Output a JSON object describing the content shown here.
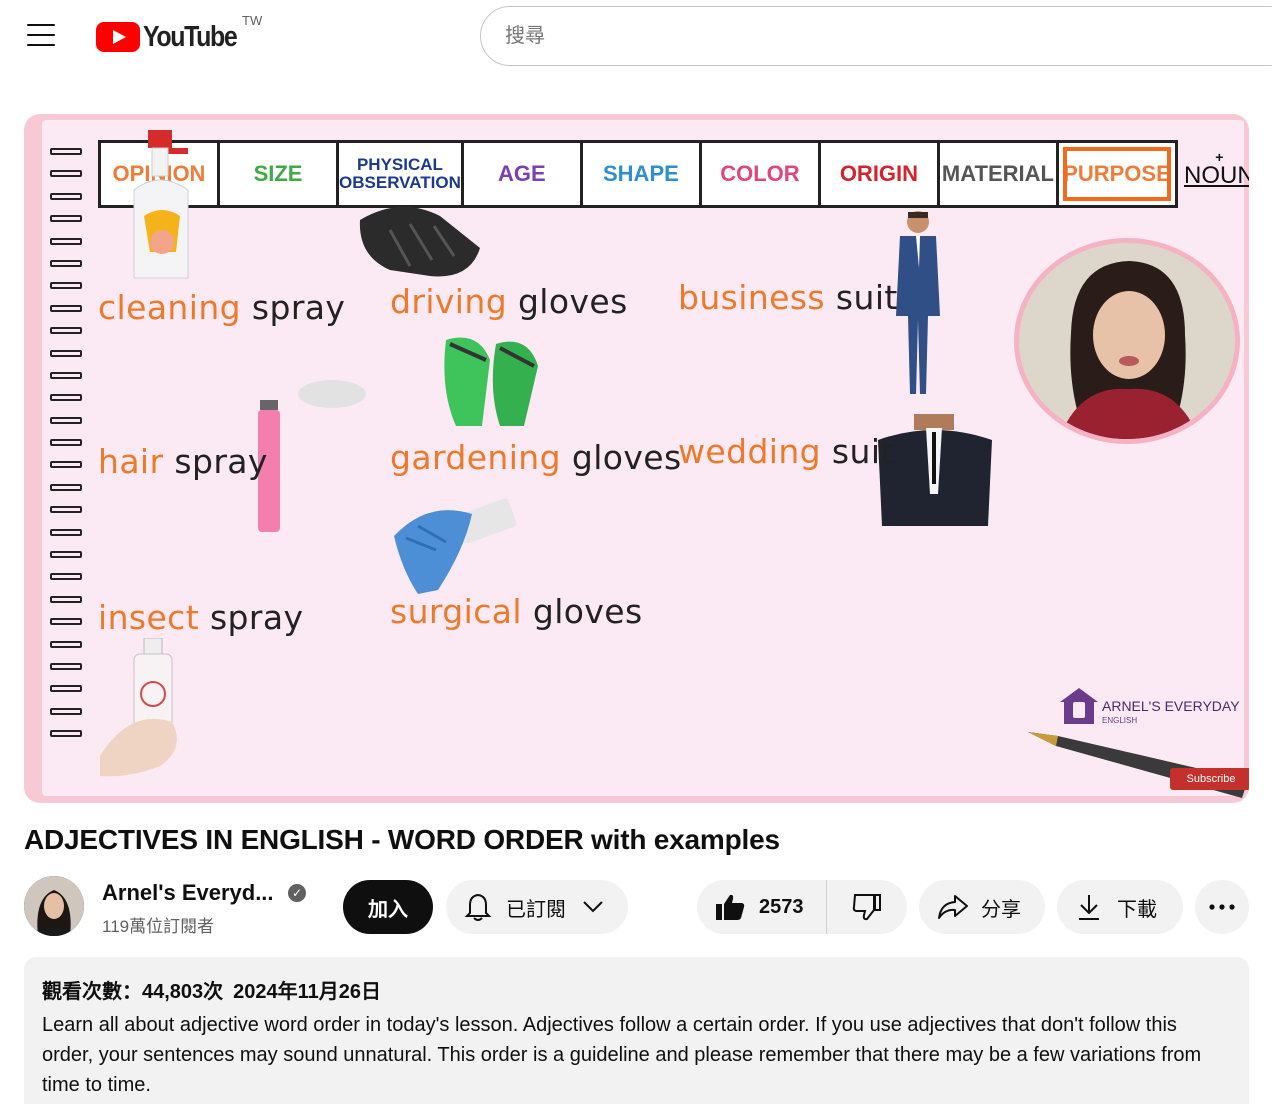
{
  "header": {
    "logo_text": "YouTube",
    "region": "TW",
    "search_placeholder": "搜尋"
  },
  "player": {
    "order_headers": [
      {
        "label": "OPINION",
        "color": "#ee7d3a"
      },
      {
        "label": "SIZE",
        "color": "#3daa43"
      },
      {
        "label": "PHYSICAL OBSERVATION",
        "color": "#1b3a8f"
      },
      {
        "label": "AGE",
        "color": "#7a3fb3"
      },
      {
        "label": "SHAPE",
        "color": "#2d8fd0"
      },
      {
        "label": "COLOR",
        "color": "#e0457b"
      },
      {
        "label": "ORIGIN",
        "color": "#d3232d"
      },
      {
        "label": "MATERIAL",
        "color": "#555555"
      },
      {
        "label": "PURPOSE",
        "color": "#ee7d3a"
      }
    ],
    "noun_plus": "+",
    "noun_label": "NOUN",
    "phrases": [
      {
        "adj": "cleaning",
        "noun": "spray"
      },
      {
        "adj": "hair",
        "noun": "spray"
      },
      {
        "adj": "insect",
        "noun": "spray"
      },
      {
        "adj": "driving",
        "noun": "gloves"
      },
      {
        "adj": "gardening",
        "noun": "gloves"
      },
      {
        "adj": "surgical",
        "noun": "gloves"
      },
      {
        "adj": "business",
        "noun": "suit"
      },
      {
        "adj": "wedding",
        "noun": "suit"
      }
    ],
    "brand_name": "ARNEL'S EVERYDAY",
    "brand_sub": "ENGLISH",
    "subscribe_chip": "Subscribe"
  },
  "video": {
    "title": "ADJECTIVES IN ENGLISH - WORD ORDER with examples"
  },
  "channel": {
    "name": "Arnel's Everyd...",
    "subscribers": "119萬位訂閱者",
    "join_label": "加入",
    "subscribed_label": "已訂閱"
  },
  "actions": {
    "like_count": "2573",
    "share_label": "分享",
    "download_label": "下載"
  },
  "description": {
    "views": "觀看次數：44,803次",
    "date": "2024年11月26日",
    "text": "Learn all about adjective word order in today's lesson. Adjectives follow a certain order. If you use adjectives that don't follow this order, your sentences may sound unnatural. This order is a guideline and please remember that there may be a few variations from time to time."
  }
}
